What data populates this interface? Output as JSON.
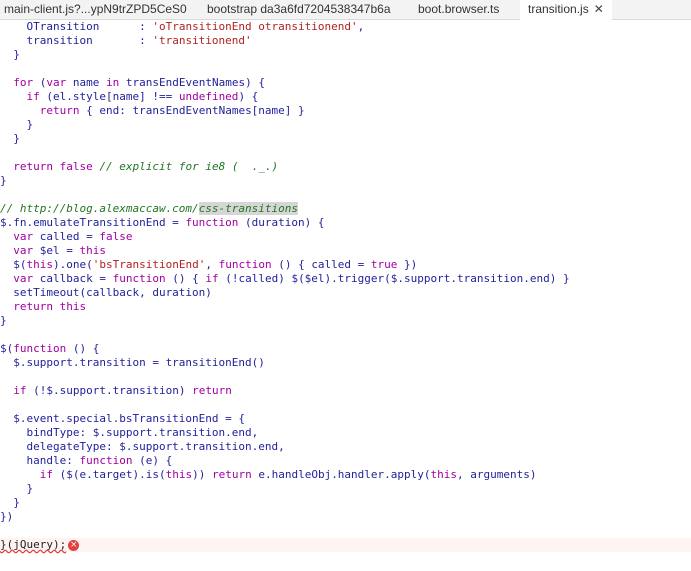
{
  "tabs": [
    {
      "label": "main-client.js?...ypN9trZPD5CeS0",
      "active": false
    },
    {
      "label": "bootstrap da3a6fd7204538347b6a",
      "active": false
    },
    {
      "label": "boot.browser.ts",
      "active": false
    },
    {
      "label": "transition.js",
      "active": true
    }
  ],
  "tab_close_glyph": "✕",
  "code_lines": [
    [
      "    OTransition      : 'oTransitionEnd otransitionend',"
    ],
    [
      "    transition       : 'transitionend'"
    ],
    [
      "  }"
    ],
    [
      ""
    ],
    [
      "  for (var name in transEndEventNames) {"
    ],
    [
      "    if (el.style[name] !== undefined) {"
    ],
    [
      "      return { end: transEndEventNames[name] }"
    ],
    [
      "    }"
    ],
    [
      "  }"
    ],
    [
      ""
    ],
    [
      "  return false // explicit for ie8 (  ._.)"
    ],
    [
      "}"
    ],
    [
      ""
    ],
    [
      "// http://blog.alexmaccaw.com/css-transitions"
    ],
    [
      "$.fn.emulateTransitionEnd = function (duration) {"
    ],
    [
      "  var called = false"
    ],
    [
      "  var $el = this"
    ],
    [
      "  $(this).one('bsTransitionEnd', function () { called = true })"
    ],
    [
      "  var callback = function () { if (!called) $($el).trigger($.support.transition.end) }"
    ],
    [
      "  setTimeout(callback, duration)"
    ],
    [
      "  return this"
    ],
    [
      "}"
    ],
    [
      ""
    ],
    [
      "$(function () {"
    ],
    [
      "  $.support.transition = transitionEnd()"
    ],
    [
      ""
    ],
    [
      "  if (!$.support.transition) return"
    ],
    [
      ""
    ],
    [
      "  $.event.special.bsTransitionEnd = {"
    ],
    [
      "    bindType: $.support.transition.end,"
    ],
    [
      "    delegateType: $.support.transition.end,"
    ],
    [
      "    handle: function (e) {"
    ],
    [
      "      if ($(e.target).is(this)) return e.handleObj.handler.apply(this, arguments)"
    ],
    [
      "    }"
    ],
    [
      "  }"
    ],
    [
      "})"
    ],
    [
      ""
    ],
    [
      "}(jQuery);"
    ]
  ],
  "error_icon": "error-icon",
  "colors": {
    "string": "#b22222",
    "keyword": "#a000a0",
    "comment": "#237523",
    "identifier": "#1f1f99",
    "error": "#e04040"
  }
}
